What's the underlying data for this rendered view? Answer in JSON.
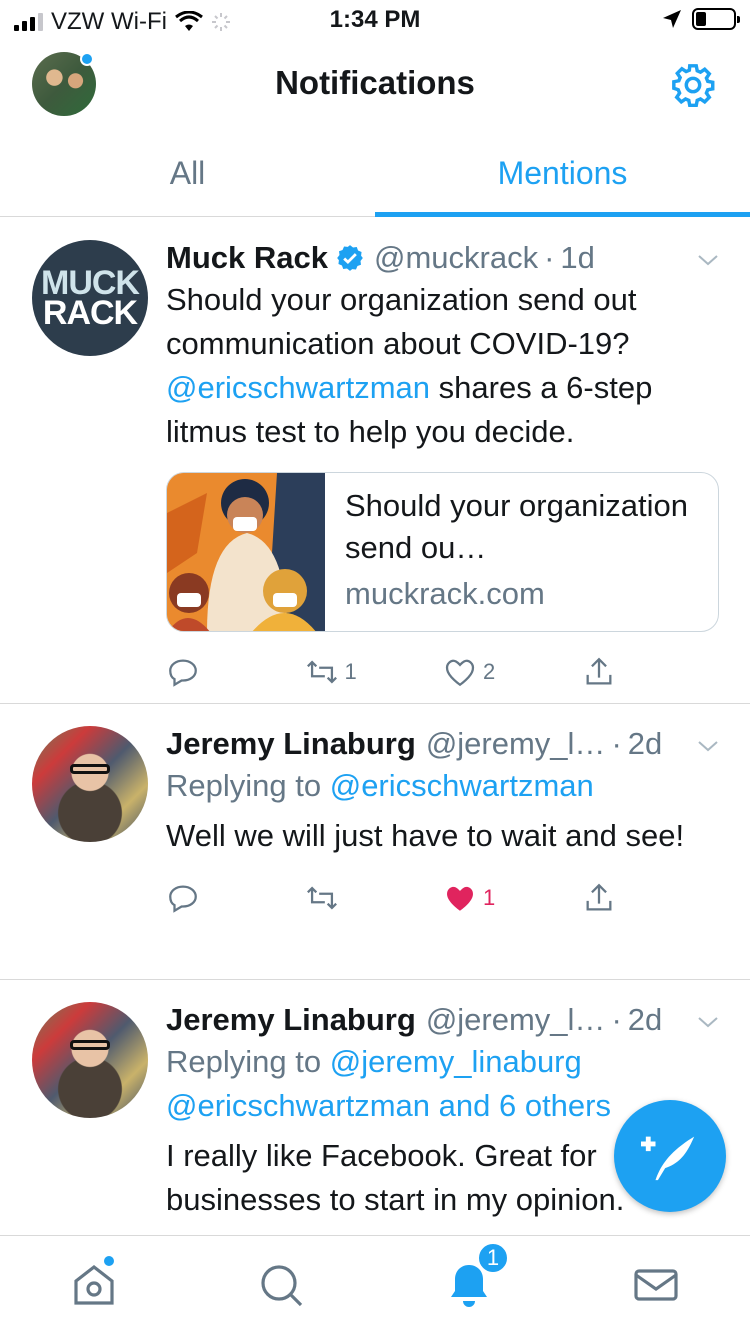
{
  "status_bar": {
    "carrier": "VZW Wi-Fi",
    "time": "1:34 PM"
  },
  "header": {
    "title": "Notifications"
  },
  "tabs": [
    {
      "label": "All",
      "active": false
    },
    {
      "label": "Mentions",
      "active": true
    }
  ],
  "tweets": [
    {
      "name": "Muck Rack",
      "avatar_text": [
        "MUCK",
        "RACK"
      ],
      "handle": "@muckrack",
      "time": "1d",
      "text_parts": [
        "Should your organization send out communication about COVID-19? ",
        "@ericschwartzman",
        " shares a 6-step litmus test to help you decide."
      ],
      "card": {
        "title": "Should your organization send ou…",
        "domain": "muckrack.com"
      },
      "actions": {
        "reply": "",
        "retweet": "1",
        "like": "2"
      }
    },
    {
      "name": "Jeremy Linaburg",
      "handle": "@jeremy_l…",
      "time": "2d",
      "reply_prefix": "Replying to ",
      "reply_to": "@ericschwartzman",
      "text": "Well we will just have to wait and see!",
      "actions": {
        "reply": "",
        "retweet": "",
        "like": "1"
      }
    },
    {
      "name": "Jeremy Linaburg",
      "handle": "@jeremy_l…",
      "time": "2d",
      "reply_prefix": "Replying to ",
      "reply_to": "@jeremy_linaburg @ericschwartzman and 6 others",
      "text": "I really like Facebook. Great for businesses to start in my opinion."
    }
  ],
  "bottom_nav": {
    "notifications_badge": "1"
  },
  "colors": {
    "accent": "#1da1f2",
    "like": "#e0245e",
    "muted": "#657786"
  }
}
